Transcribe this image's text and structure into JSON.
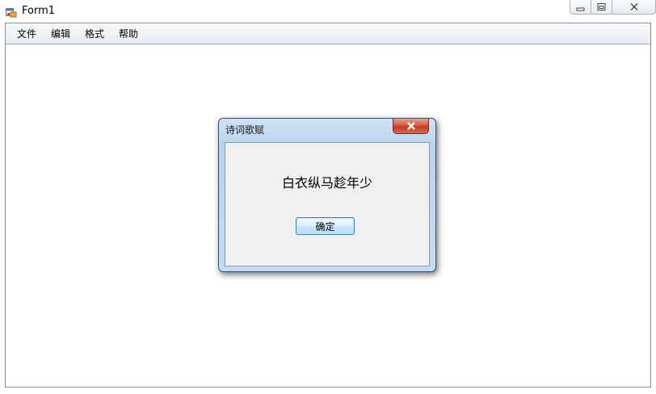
{
  "window": {
    "title": "Form1",
    "app_icon": "form-app-icon",
    "caption_buttons": [
      "minimize-icon",
      "restore-icon",
      "close-icon"
    ]
  },
  "menu": {
    "items": [
      {
        "label": "文件"
      },
      {
        "label": "编辑"
      },
      {
        "label": "格式"
      },
      {
        "label": "帮助"
      }
    ]
  },
  "dialog": {
    "title": "诗词歌赋",
    "message": "白衣纵马趁年少",
    "ok_label": "确定",
    "close_icon": "close-icon",
    "accent_close_color": "#c23b22"
  }
}
